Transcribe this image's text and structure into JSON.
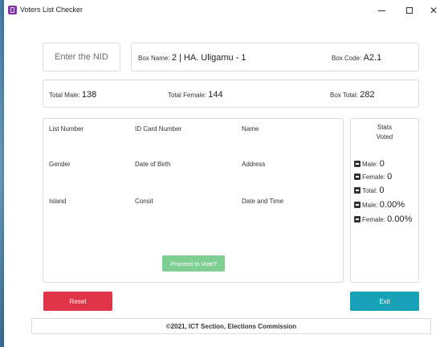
{
  "window": {
    "title": "Voters List Checker",
    "minimize_glyph": "–",
    "close_glyph": "✕"
  },
  "nid": {
    "placeholder": "Enter the NID"
  },
  "box": {
    "name_label": "Box Name:",
    "name_value": "2 | HA. Uligamu - 1",
    "code_label": "Box Code:",
    "code_value": "A2.1"
  },
  "totals": {
    "male_label": "Total Male:",
    "male_value": "138",
    "female_label": "Total Female:",
    "female_value": "144",
    "box_label": "Box Total:",
    "box_value": "282"
  },
  "details": {
    "list_number": "List Number",
    "id_card_number": "ID Card Number",
    "name": "Name",
    "gender": "Gender",
    "date_of_birth": "Date of Birth",
    "address": "Address",
    "island": "Island",
    "consit": "Consit",
    "date_and_time": "Date and Time",
    "proceed_label": "Proceed to Vote?"
  },
  "stats": {
    "title": "Stats",
    "subtitle": "Voted",
    "male_label": "Male:",
    "male_value": "0",
    "female_label": "Female:",
    "female_value": "0",
    "total_label": "Total:",
    "total_value": "0",
    "male_pct_label": "Male:",
    "male_pct_value": "0.00%",
    "female_pct_label": "Female:",
    "female_pct_value": "0.00%"
  },
  "buttons": {
    "reset": "Reset",
    "exit": "Exit"
  },
  "footer": {
    "text": "©2021, ICT Section, Elections Commission"
  },
  "colors": {
    "reset": "#e03548",
    "exit": "#17a2b8",
    "proceed": "#7fcf93",
    "app_icon": "#7a3aa0"
  },
  "icons": {
    "app": "ballot-box-icon",
    "stat_bullet": "minus-square-icon"
  }
}
